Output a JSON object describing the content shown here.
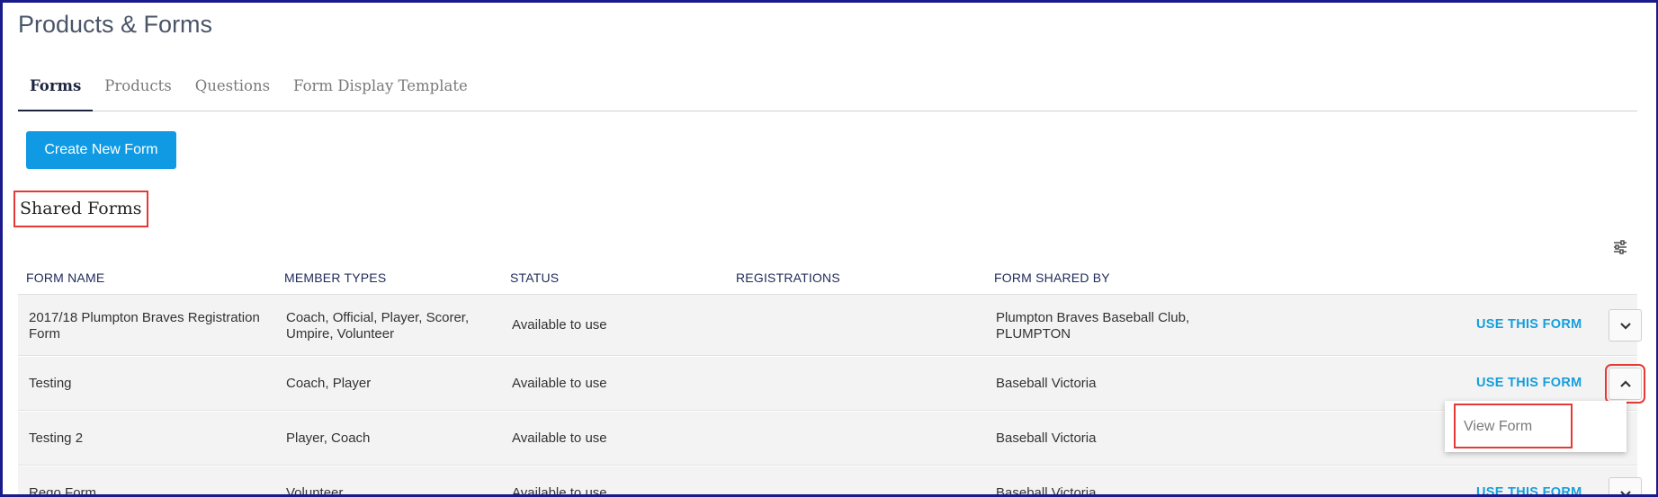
{
  "page": {
    "title": "Products & Forms"
  },
  "tabs": [
    {
      "label": "Forms",
      "active": true
    },
    {
      "label": "Products",
      "active": false
    },
    {
      "label": "Questions",
      "active": false
    },
    {
      "label": "Form Display Template",
      "active": false
    }
  ],
  "actions": {
    "create_label": "Create New Form"
  },
  "section": {
    "title": "Shared Forms"
  },
  "table": {
    "columns": [
      "FORM NAME",
      "MEMBER TYPES",
      "STATUS",
      "REGISTRATIONS",
      "FORM SHARED BY"
    ],
    "action_label": "USE THIS FORM",
    "rows": [
      {
        "name": [
          "2017/18 Plumpton Braves Registration",
          "Form"
        ],
        "member_types": [
          "Coach, Official, Player, Scorer,",
          "Umpire, Volunteer"
        ],
        "status": "Available to use",
        "registrations": "",
        "shared_by": [
          "Plumpton Braves Baseball Club,",
          "PLUMPTON"
        ],
        "expanded": false
      },
      {
        "name": [
          "Testing"
        ],
        "member_types": [
          "Coach, Player"
        ],
        "status": "Available to use",
        "registrations": "",
        "shared_by": [
          "Baseball Victoria"
        ],
        "expanded": true
      },
      {
        "name": [
          "Testing 2"
        ],
        "member_types": [
          "Player, Coach"
        ],
        "status": "Available to use",
        "registrations": "",
        "shared_by": [
          "Baseball Victoria"
        ],
        "expanded": false
      },
      {
        "name": [
          "Rego Form"
        ],
        "member_types": [
          "Volunteer"
        ],
        "status": "Available to use",
        "registrations": "",
        "shared_by": [
          "Baseball Victoria"
        ],
        "expanded": false
      }
    ]
  },
  "dropdown": {
    "item_label": "View Form"
  },
  "icons": {
    "settings": "sliders-icon",
    "expand": "chevron-down-icon",
    "collapse": "chevron-up-icon"
  },
  "colors": {
    "accent": "#0f9ae3",
    "link": "#149fdd",
    "highlight": "#e53935",
    "frame": "#1a1a8a"
  }
}
